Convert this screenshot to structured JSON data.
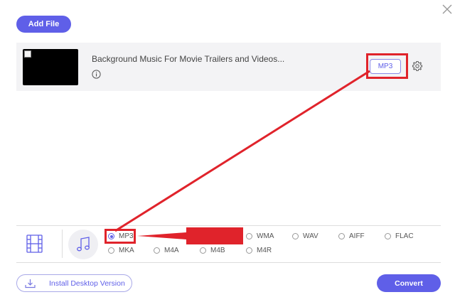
{
  "toolbar": {
    "add_file_label": "Add File"
  },
  "file": {
    "name": "Background Music For Movie Trailers and Videos...",
    "output_format": "MP3"
  },
  "formats": {
    "selected": "MP3",
    "options": [
      "MP3",
      "WMA",
      "WAV",
      "AIFF",
      "FLAC",
      "MKA",
      "M4A",
      "M4B",
      "M4R"
    ]
  },
  "footer": {
    "install_label": "Install Desktop Version",
    "convert_label": "Convert"
  },
  "colors": {
    "accent": "#5f5fe8",
    "highlight": "#e0232b"
  },
  "icons": [
    "close-icon",
    "info-icon",
    "gear-icon",
    "film-icon",
    "music-note-icon",
    "download-icon"
  ]
}
